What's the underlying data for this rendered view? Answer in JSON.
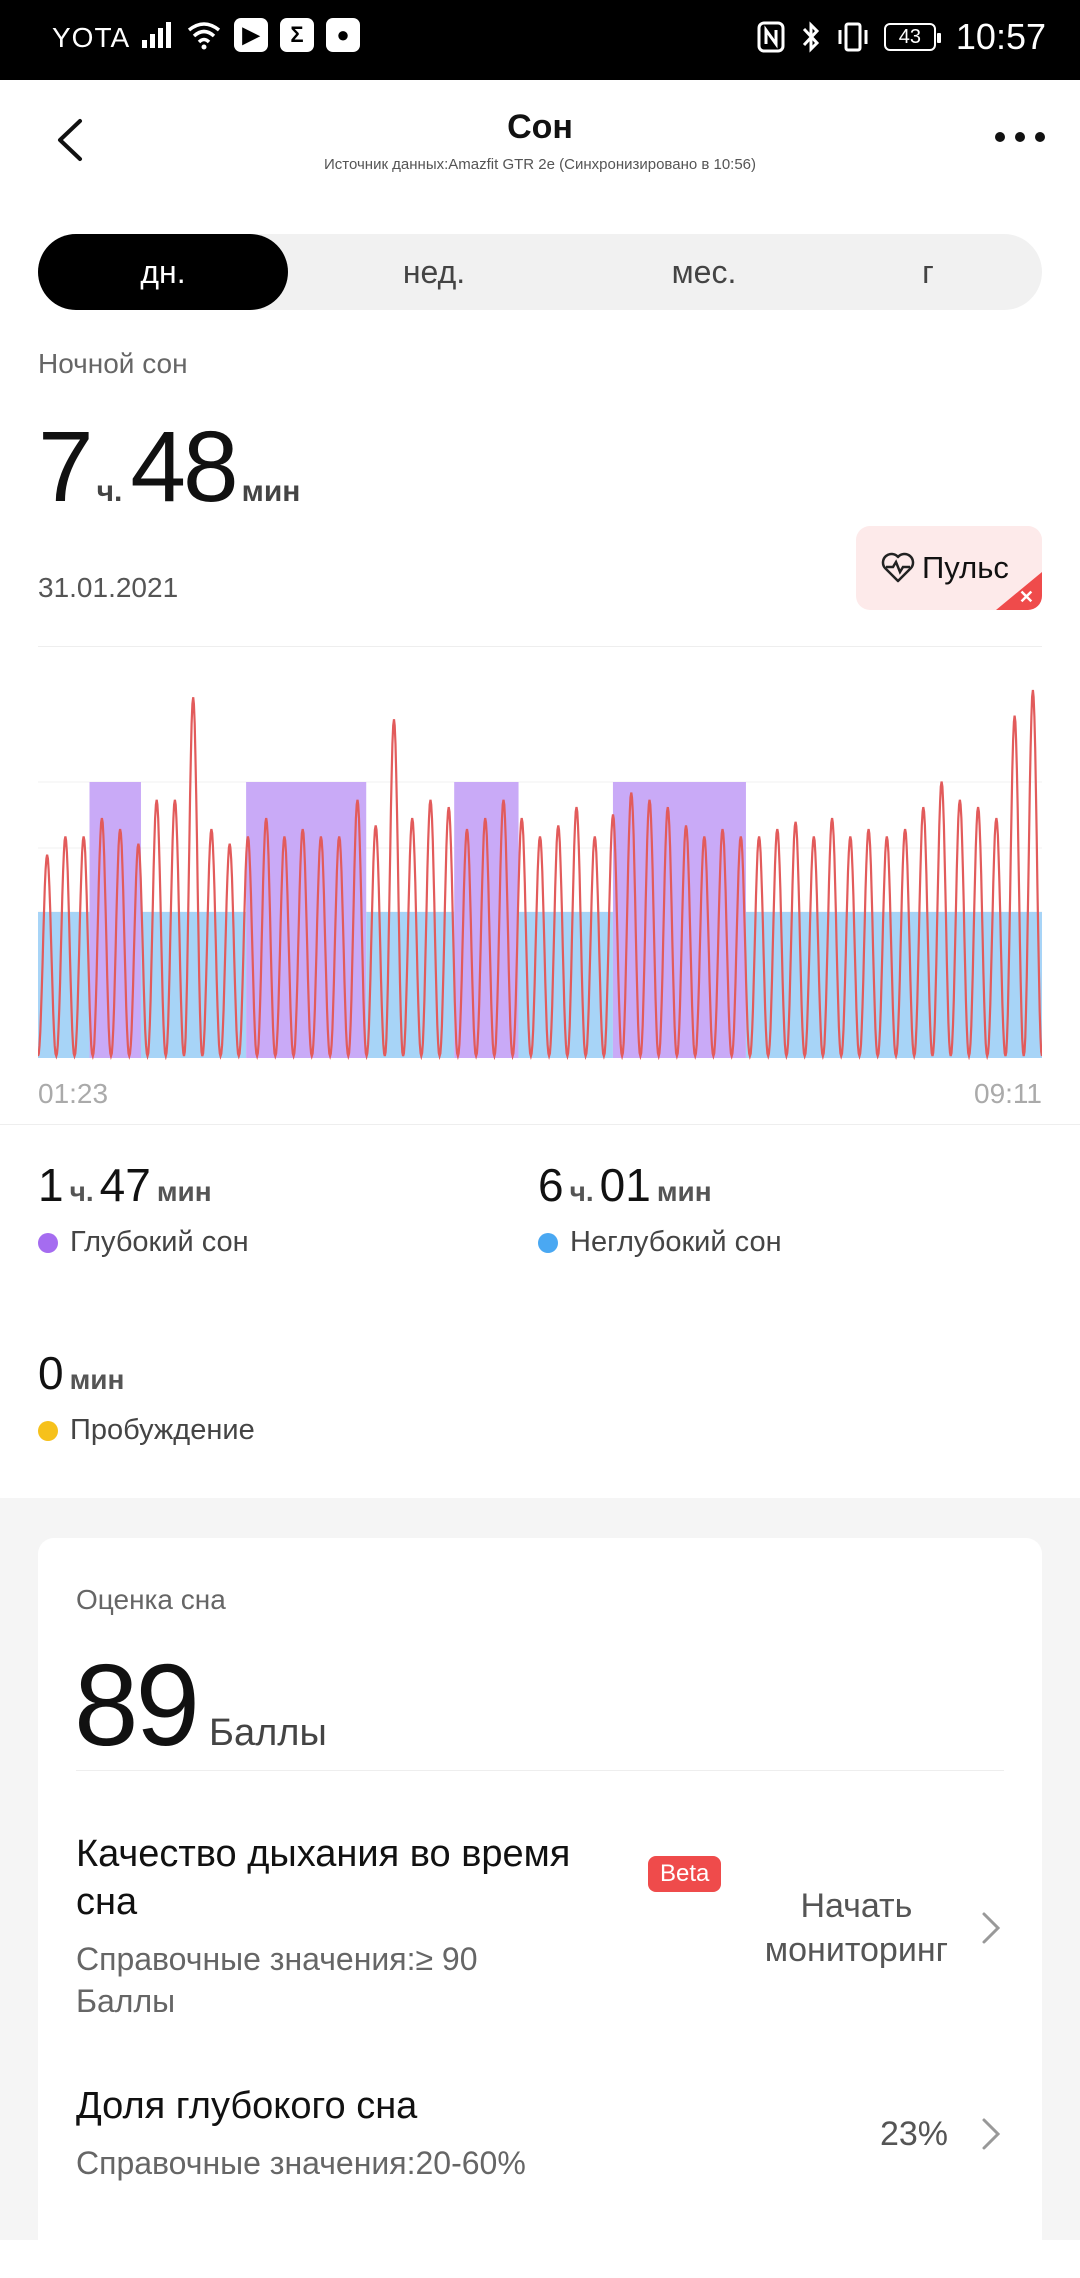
{
  "status_bar": {
    "carrier": "YOTA",
    "battery": "43",
    "time": "10:57"
  },
  "header": {
    "title": "Сон",
    "subtitle": "Источник данных:Amazfit GTR 2e (Синхронизировано в 10:56)"
  },
  "tabs": [
    {
      "label": "дн.",
      "active": true
    },
    {
      "label": "нед.",
      "active": false
    },
    {
      "label": "мес.",
      "active": false
    },
    {
      "label": "г",
      "active": false
    }
  ],
  "night_sleep": {
    "label": "Ночной сон",
    "hours": "7",
    "hours_unit": "ч.",
    "minutes": "48",
    "minutes_unit": "мин",
    "date": "31.01.2021",
    "pulse_button": "Пульс"
  },
  "colors": {
    "deep": "#c9aaf7",
    "light": "#a7d4f7",
    "pulse": "#e25b5b",
    "deep_dot": "#a56cf0",
    "light_dot": "#4aa8f2",
    "awake_dot": "#f6c11b",
    "accent_red": "#ef4b4b"
  },
  "chart_data": {
    "type": "area",
    "x_start": "01:23",
    "x_end": "09:11",
    "stages": [
      {
        "stage": "light",
        "start": "01:23",
        "end": "01:47"
      },
      {
        "stage": "deep",
        "start": "01:47",
        "end": "02:11"
      },
      {
        "stage": "light",
        "start": "02:11",
        "end": "03:00"
      },
      {
        "stage": "deep",
        "start": "03:00",
        "end": "03:56"
      },
      {
        "stage": "light",
        "start": "03:56",
        "end": "04:37"
      },
      {
        "stage": "deep",
        "start": "04:37",
        "end": "05:07"
      },
      {
        "stage": "light",
        "start": "05:07",
        "end": "05:51"
      },
      {
        "stage": "deep",
        "start": "05:51",
        "end": "06:53"
      },
      {
        "stage": "light",
        "start": "06:53",
        "end": "09:11"
      }
    ],
    "pulse_series": {
      "cycles": 46,
      "peaks": [
        0.55,
        0.6,
        0.6,
        0.65,
        0.62,
        0.58,
        0.7,
        0.7,
        0.98,
        0.62,
        0.58,
        0.6,
        0.65,
        0.6,
        0.62,
        0.6,
        0.6,
        0.7,
        0.63,
        0.92,
        0.65,
        0.7,
        0.68,
        0.62,
        0.65,
        0.7,
        0.65,
        0.6,
        0.63,
        0.68,
        0.6,
        0.66,
        0.72,
        0.7,
        0.68,
        0.63,
        0.6,
        0.62,
        0.6,
        0.6,
        0.62,
        0.64,
        0.6,
        0.65,
        0.6,
        0.62,
        0.6,
        0.62,
        0.68,
        0.75,
        0.7,
        0.68,
        0.65,
        0.93,
        1.0
      ]
    },
    "legend": [
      "Глубокий сон",
      "Неглубокий сон",
      "Пробуждение"
    ]
  },
  "stats": [
    {
      "hours": "1",
      "hours_unit": "ч.",
      "minutes": "47",
      "minutes_unit": "мин",
      "label": "Глубокий сон"
    },
    {
      "hours": "6",
      "hours_unit": "ч.",
      "minutes": "01",
      "minutes_unit": "мин",
      "label": "Неглубокий сон"
    },
    {
      "minutes": "0",
      "minutes_unit": "мин",
      "label": "Пробуждение"
    }
  ],
  "score_card": {
    "label": "Оценка сна",
    "score": "89",
    "score_unit": "Баллы",
    "breathing": {
      "title_line1": "Качество дыхания во время",
      "title_line2": "сна",
      "beta": "Beta",
      "ref_line1": "Справочные значения:≥ 90",
      "ref_line2": "Баллы",
      "action_line1": "Начать",
      "action_line2": "мониторинг"
    },
    "deep_share": {
      "title": "Доля глубокого сна",
      "ref": "Справочные значения:20-60%",
      "value": "23%"
    }
  }
}
